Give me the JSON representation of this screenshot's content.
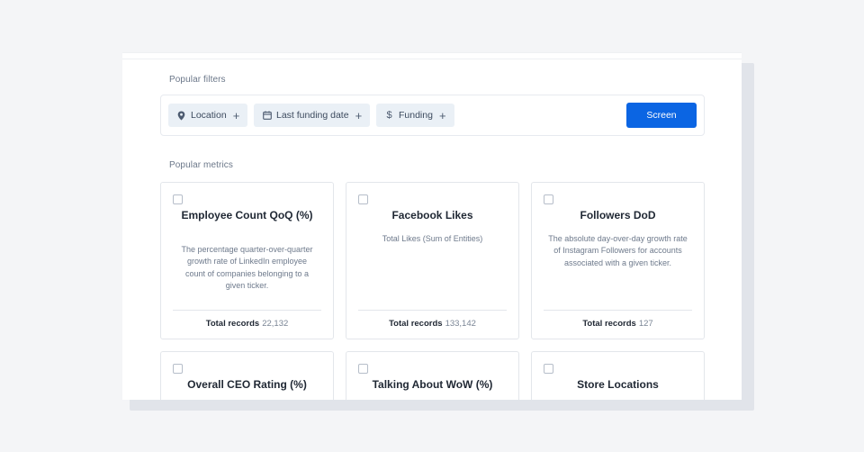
{
  "popular_filters": {
    "label": "Popular filters",
    "chips": [
      {
        "label": "Location",
        "icon": "location-pin-icon"
      },
      {
        "label": "Last funding date",
        "icon": "calendar-icon"
      },
      {
        "label": "Funding",
        "icon": "dollar-icon"
      }
    ],
    "screen_button": "Screen"
  },
  "popular_metrics": {
    "label": "Popular metrics",
    "cards": [
      {
        "title": "Employee Count QoQ (%)",
        "description": "The percentage quarter-over-quarter growth rate of LinkedIn employee count of companies belonging to a given ticker.",
        "records_label": "Total records",
        "records_value": "22,132"
      },
      {
        "title": "Facebook Likes",
        "description": "Total Likes (Sum of Entities)",
        "records_label": "Total records",
        "records_value": "133,142"
      },
      {
        "title": "Followers DoD",
        "description": "The absolute day-over-day growth rate of Instagram Followers for accounts associated with a given ticker.",
        "records_label": "Total records",
        "records_value": "127"
      },
      {
        "title": "Overall CEO Rating (%)"
      },
      {
        "title": "Talking About WoW (%)"
      },
      {
        "title": "Store Locations"
      }
    ]
  },
  "colors": {
    "primary_button": "#0b65e3",
    "chip_background": "#eaf0f6",
    "page_background": "#f4f5f7"
  }
}
